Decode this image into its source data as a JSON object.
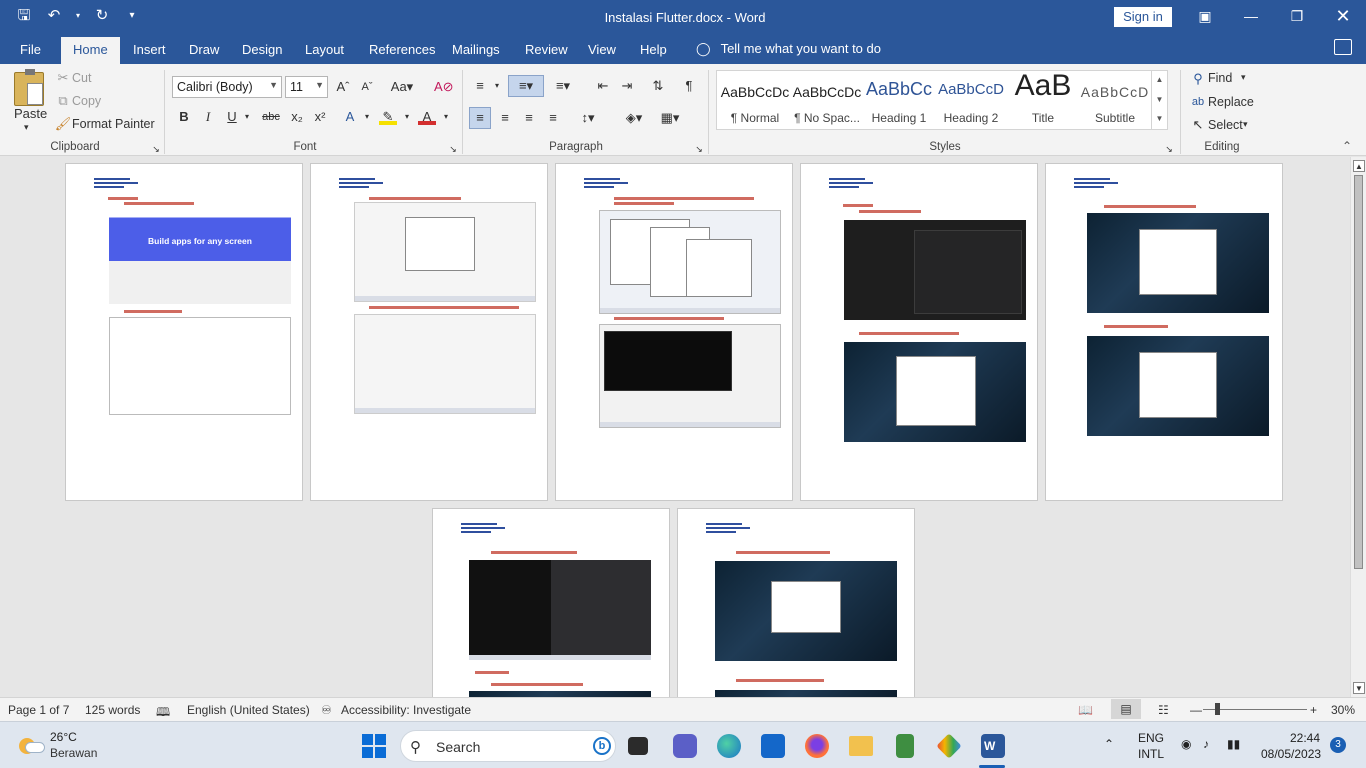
{
  "window": {
    "doc_title": "Instalasi Flutter.docx  -  Word",
    "sign_in": "Sign in"
  },
  "tabs": [
    "File",
    "Home",
    "Insert",
    "Draw",
    "Design",
    "Layout",
    "References",
    "Mailings",
    "Review",
    "View",
    "Help"
  ],
  "tell_me": "Tell me what you want to do",
  "clipboard": {
    "paste": "Paste",
    "cut": "Cut",
    "copy": "Copy",
    "format_painter": "Format Painter",
    "label": "Clipboard"
  },
  "font": {
    "name": "Calibri (Body)",
    "size": "11",
    "label": "Font"
  },
  "paragraph": {
    "label": "Paragraph"
  },
  "styles": {
    "label": "Styles",
    "items": [
      {
        "sample": "AaBbCcDc",
        "name": "¶ Normal"
      },
      {
        "sample": "AaBbCcDc",
        "name": "¶ No Spac..."
      },
      {
        "sample": "AaBbCc",
        "name": "Heading 1"
      },
      {
        "sample": "AaBbCcD",
        "name": "Heading 2"
      },
      {
        "sample": "AaB",
        "name": "Title"
      },
      {
        "sample": "AaBbCcD",
        "name": "Subtitle"
      }
    ]
  },
  "editing": {
    "find": "Find",
    "replace": "Replace",
    "select": "Select",
    "label": "Editing"
  },
  "pages": {
    "p1_hero": "Build apps for any screen"
  },
  "status": {
    "page": "Page 1 of 7",
    "words": "125 words",
    "language": "English (United States)",
    "accessibility": "Accessibility: Investigate",
    "zoom": "30%"
  },
  "taskbar": {
    "weather_temp": "26°C",
    "weather_desc": "Berawan",
    "search": "Search",
    "lang_top": "ENG",
    "lang_bottom": "INTL",
    "time": "22:44",
    "date": "08/05/2023",
    "notifications": "3"
  }
}
